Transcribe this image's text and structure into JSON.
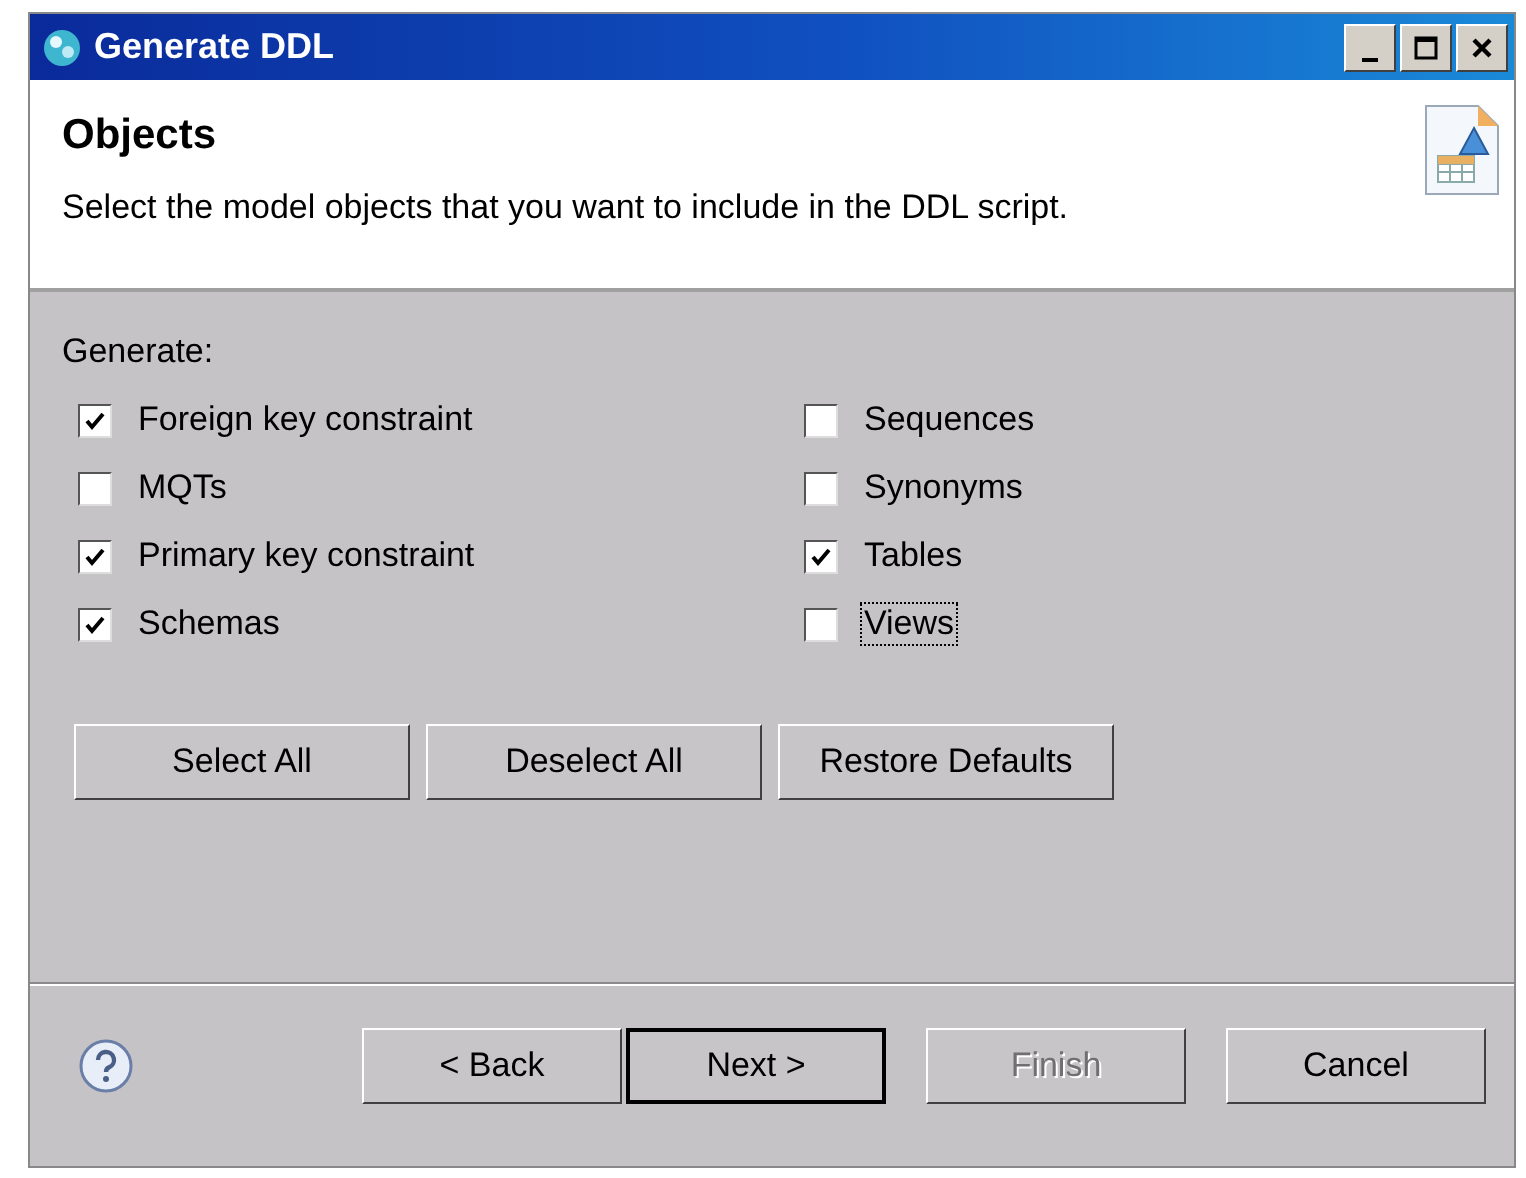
{
  "window": {
    "title": "Generate DDL"
  },
  "header": {
    "title": "Objects",
    "description": "Select the model objects that you want to include in the DDL script."
  },
  "generate": {
    "label": "Generate:",
    "columns": [
      [
        {
          "label": "Foreign key constraint",
          "checked": true,
          "focused": false
        },
        {
          "label": "MQTs",
          "checked": false,
          "focused": false
        },
        {
          "label": "Primary key constraint",
          "checked": true,
          "focused": false
        },
        {
          "label": "Schemas",
          "checked": true,
          "focused": false
        }
      ],
      [
        {
          "label": "Sequences",
          "checked": false,
          "focused": false
        },
        {
          "label": "Synonyms",
          "checked": false,
          "focused": false
        },
        {
          "label": "Tables",
          "checked": true,
          "focused": false
        },
        {
          "label": "Views",
          "checked": false,
          "focused": true
        }
      ]
    ]
  },
  "selection_buttons": [
    "Select All",
    "Deselect All",
    "Restore Defaults"
  ],
  "footer_buttons": [
    {
      "label": "< Back",
      "default": false,
      "disabled": false
    },
    {
      "label": "Next >",
      "default": true,
      "disabled": false
    },
    {
      "label": "Finish",
      "default": false,
      "disabled": true
    },
    {
      "label": "Cancel",
      "default": false,
      "disabled": false
    }
  ]
}
